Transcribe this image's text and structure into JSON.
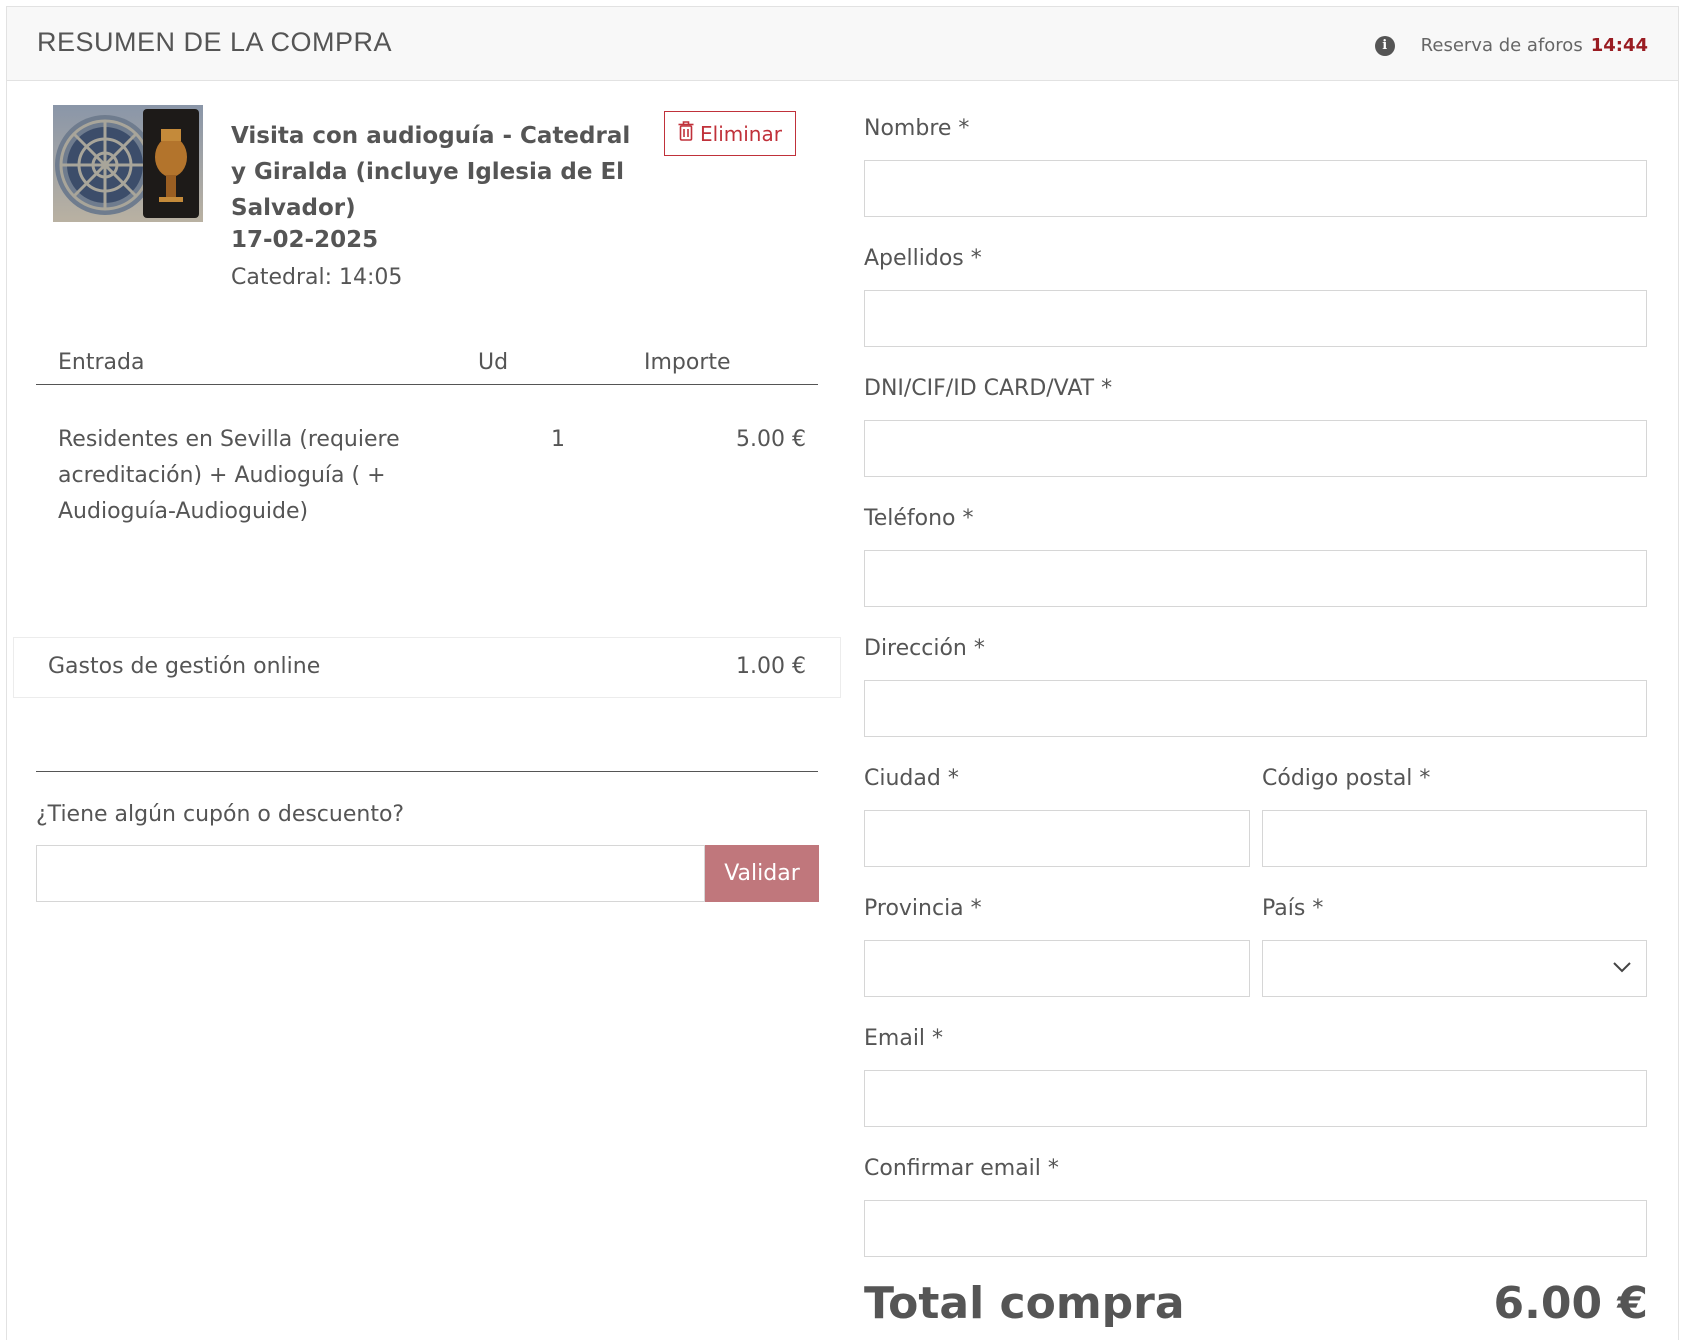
{
  "header": {
    "title": "RESUMEN DE LA COMPRA",
    "reserva_label": "Reserva de aforos",
    "reserva_time": "14:44"
  },
  "event": {
    "title": "Visita con audioguía - Catedral y Giralda (incluye Iglesia de El Salvador)",
    "date": "17-02-2025",
    "time": "Catedral: 14:05",
    "delete_label": "Eliminar"
  },
  "table": {
    "headers": [
      "Entrada",
      "Ud",
      "Importe"
    ],
    "rows": [
      {
        "entrada": "Residentes en Sevilla (requiere acreditación) + Audioguía ( + Audioguía-Audioguide)",
        "ud": "1",
        "importe": "5.00 €"
      }
    ]
  },
  "fees": {
    "label": "Gastos de gestión online",
    "value": "1.00 €"
  },
  "coupon": {
    "question": "¿Tiene algún cupón o descuento?",
    "value": "",
    "button": "Validar"
  },
  "form": {
    "nombre": {
      "label": "Nombre *",
      "value": ""
    },
    "apellidos": {
      "label": "Apellidos *",
      "value": ""
    },
    "dni": {
      "label": "DNI/CIF/ID CARD/VAT *",
      "value": ""
    },
    "telefono": {
      "label": "Teléfono *",
      "value": ""
    },
    "direccion": {
      "label": "Dirección *",
      "value": ""
    },
    "ciudad": {
      "label": "Ciudad *",
      "value": ""
    },
    "codigo_postal": {
      "label": "Código postal *",
      "value": ""
    },
    "provincia": {
      "label": "Provincia *",
      "value": ""
    },
    "pais": {
      "label": "País *",
      "selected": ""
    },
    "email": {
      "label": "Email *",
      "value": ""
    },
    "confirmar_email": {
      "label": "Confirmar email *",
      "value": ""
    }
  },
  "total": {
    "label": "Total compra",
    "value": "6.00 €"
  },
  "colors": {
    "accent": "#c0313a",
    "button": "#c0777c",
    "timer": "#9a1c22",
    "text": "#555555"
  },
  "icons": [
    "info-icon",
    "trash-icon",
    "chevron-down-icon"
  ]
}
